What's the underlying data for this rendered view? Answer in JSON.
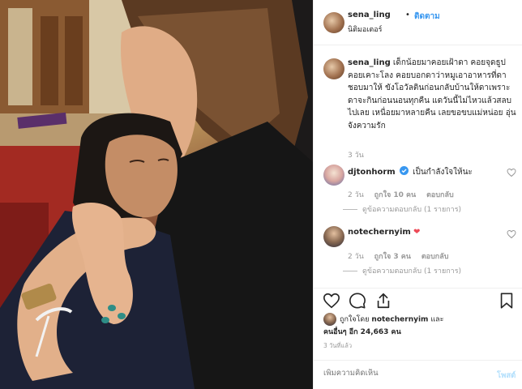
{
  "post": {
    "username": "sena_ling",
    "follow_label": "ติดตาม",
    "location": "นิติมอเตอร์",
    "caption": "เด็กน้อยมาคอยเฝ้าดา คอยจุดธูป คอยเคาะโลง คอยบอกดาว่าหมูเอาอาหารที่ดาชอบมาให้ ขังโอวัลตินก่อนกลับบ้านให้ดาเพราะดาจะกินก่อนนอนทุกคืน แดวันนี้ไม่ไหวแล้วสลบไปเลย เหนื่อยมาหลายคืน เลยขอขบแม่หน่อย อุ่นจังความรัก",
    "caption_time": "3 วัน"
  },
  "comments": [
    {
      "username": "djtonhorm",
      "verified": true,
      "text": "เป็นกำลังใจให้นะ",
      "time": "2 วัน",
      "likes": "ถูกใจ 10 คน",
      "reply_label": "ตอบกลับ",
      "view_replies": "ดูข้อความตอบกลับ (1 รายการ)"
    },
    {
      "username": "notechernyim",
      "text": "❤",
      "time": "2 วัน",
      "likes": "ถูกใจ 3 คน",
      "reply_label": "ตอบกลับ",
      "view_replies": "ดูข้อความตอบกลับ (1 รายการ)"
    }
  ],
  "likes": {
    "liked_by_prefix": "ถูกใจโดย",
    "liked_by_user": "notechernyim",
    "liked_by_suffix": "และ",
    "others": "คนอื่นๆ อีก 24,663 คน"
  },
  "posted_ago": "3 วันที่แล้ว",
  "add_comment": {
    "placeholder": "เพิ่มความคิดเห็น",
    "post_label": "โพสต์"
  },
  "icons": {
    "like": "heart-icon",
    "comment": "comment-icon",
    "share": "share-icon",
    "save": "bookmark-icon",
    "verified": "verified-badge-icon"
  },
  "colors": {
    "accent": "#3897f0",
    "heart_red": "#ed4956",
    "muted": "#999999"
  }
}
